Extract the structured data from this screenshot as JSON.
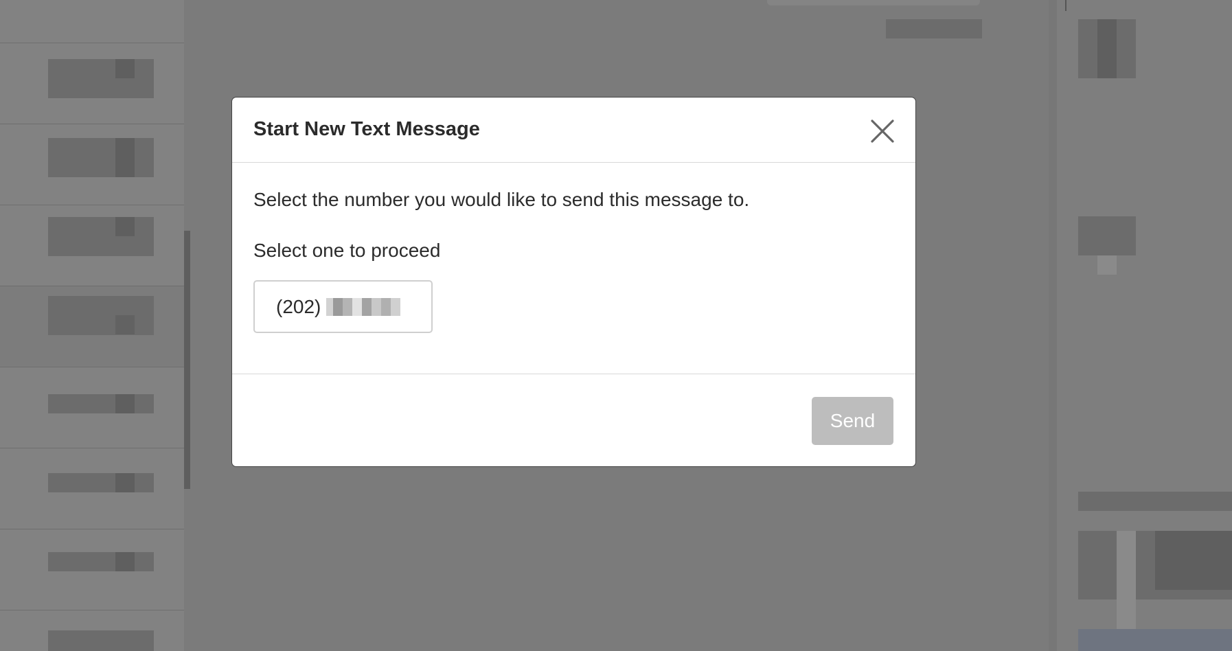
{
  "modal": {
    "title": "Start New Text Message",
    "instruction": "Select the number you would like to send this message to.",
    "sub_instruction": "Select one to proceed",
    "phone_option": {
      "area_code": "(202)",
      "redacted": true
    },
    "send_label": "Send",
    "send_disabled": true
  },
  "colors": {
    "overlay": "#7b7b7b",
    "send_disabled_bg": "#bdbdbd",
    "title_text": "#2b2b2b"
  },
  "icons": {
    "close": "close-icon"
  }
}
